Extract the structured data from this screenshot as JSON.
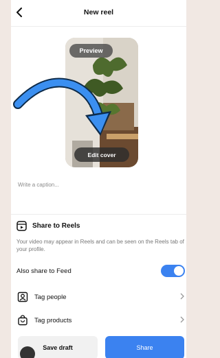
{
  "header": {
    "title": "New reel"
  },
  "preview": {
    "preview_label": "Preview",
    "edit_cover_label": "Edit cover"
  },
  "caption": {
    "placeholder": "Write a caption..."
  },
  "share_to_reels": {
    "title": "Share to Reels",
    "description": "Your video may appear in Reels and can be seen on the Reels tab of your profile."
  },
  "options": {
    "also_share_label": "Also share to Feed",
    "also_share_enabled": true,
    "tag_people_label": "Tag people",
    "tag_products_label": "Tag products"
  },
  "footer": {
    "save_draft_label": "Save draft",
    "share_label": "Share"
  },
  "colors": {
    "accent": "#3b82f0",
    "background": "#f1e8e3"
  }
}
